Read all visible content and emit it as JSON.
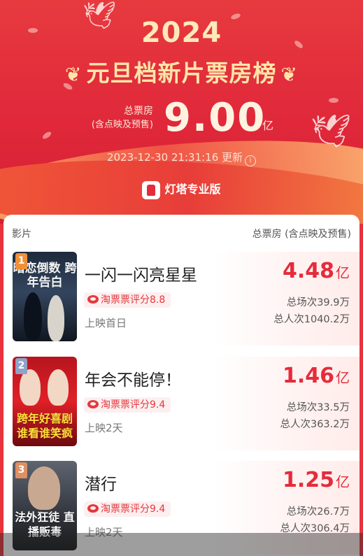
{
  "header": {
    "year": "2024",
    "title": "元旦档新片票房榜",
    "total_label_main": "总票房",
    "total_label_sub": "(含点映及预售)",
    "total_value": "9.00",
    "total_unit": "亿",
    "update_time": "2023-12-30 21:31:16",
    "update_suffix": "更新",
    "brand": "灯塔专业版"
  },
  "list": {
    "col_movie": "影片",
    "col_box": "总票房 (含点映及预售)",
    "rows": [
      {
        "rank": "1",
        "name": "一闪一闪亮星星",
        "score": "淘票票评分8.8",
        "release": "上映首日",
        "box_value": "4.48",
        "box_unit": "亿",
        "shows": "总场次39.9万",
        "viewers": "总人次1040.2万",
        "poster_text": "暗恋倒数 跨年告白"
      },
      {
        "rank": "2",
        "name": "年会不能停！",
        "score": "淘票票评分9.4",
        "release": "上映2天",
        "box_value": "1.46",
        "box_unit": "亿",
        "shows": "总场次33.5万",
        "viewers": "总人次363.2万",
        "poster_text": "跨年好喜剧 谁看谁笑疯"
      },
      {
        "rank": "3",
        "name": "潜行",
        "score": "淘票票评分9.4",
        "release": "上映2天",
        "box_value": "1.25",
        "box_unit": "亿",
        "shows": "总场次26.7万",
        "viewers": "总人次306.4万",
        "poster_text": "法外狂徒 直播贩毒"
      }
    ]
  },
  "colors": {
    "header_red": "#e0283a",
    "gold_text": "#ffe6a8",
    "accent_red": "#e62b3b"
  }
}
